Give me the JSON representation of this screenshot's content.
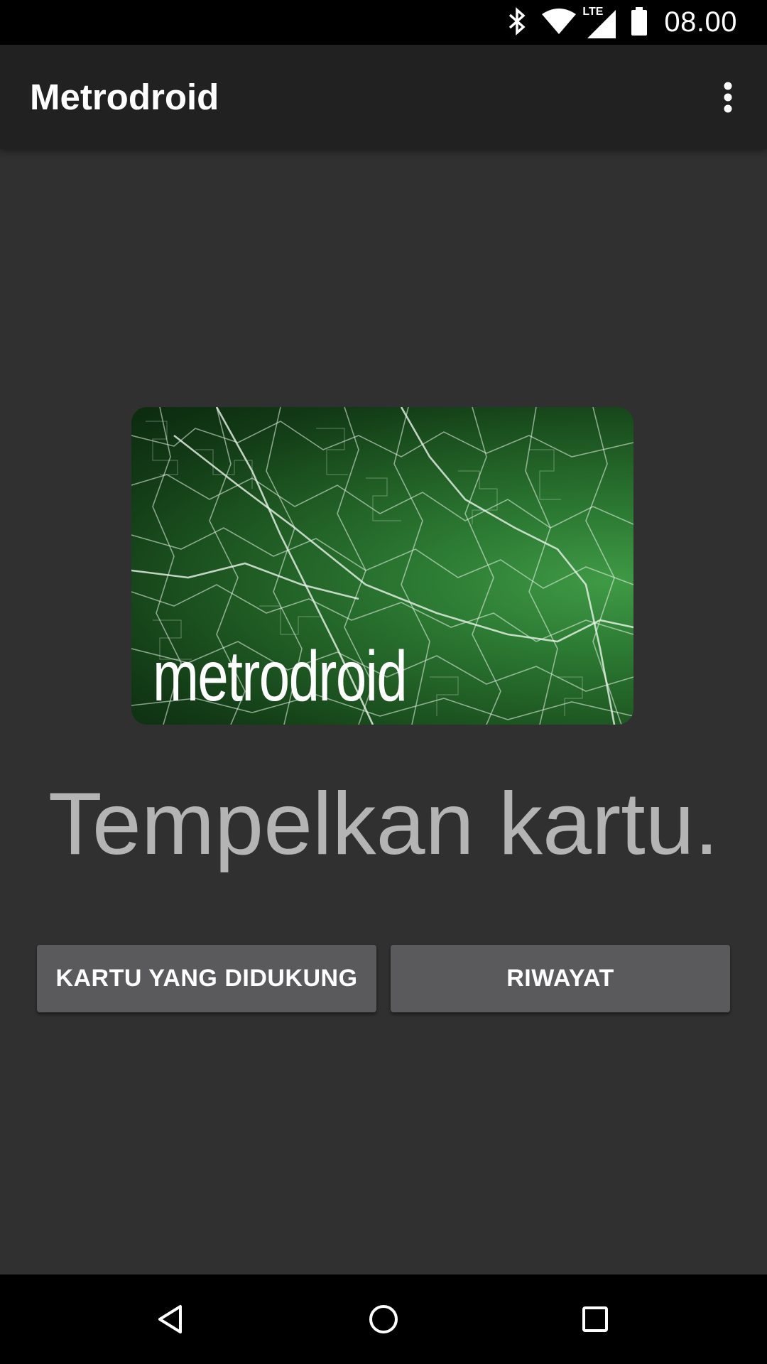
{
  "status_bar": {
    "time": "08.00",
    "icons": [
      "bluetooth-icon",
      "wifi-icon",
      "lte-signal-icon",
      "battery-icon"
    ],
    "network_label": "LTE"
  },
  "app_bar": {
    "title": "Metrodroid",
    "overflow_icon": "more-vert-icon"
  },
  "card": {
    "logo_text": "metrodroid"
  },
  "prompt": "Tempelkan kartu.",
  "buttons": {
    "supported_cards": "KARTU YANG DIDUKUNG",
    "history": "RIWAYAT"
  },
  "nav_bar": {
    "icons": [
      "back-icon",
      "home-icon",
      "recents-icon"
    ]
  },
  "colors": {
    "background": "#303030",
    "app_bar": "#212121",
    "button": "#5a5a5c",
    "prompt_text": "#b4b4b4",
    "card_green": "#2c7a33"
  }
}
